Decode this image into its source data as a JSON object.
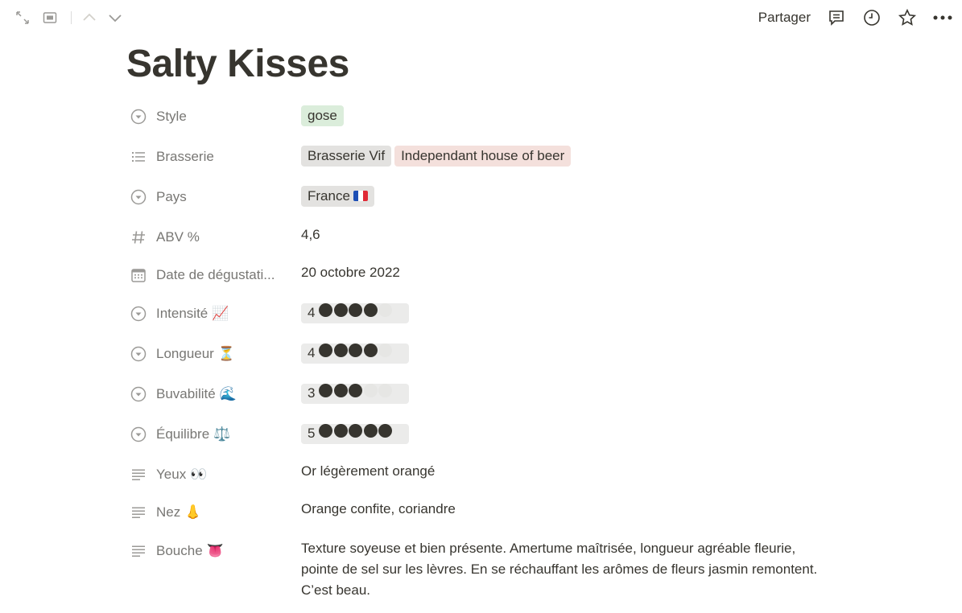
{
  "topbar": {
    "share_label": "Partager",
    "left_icons": [
      "expand-icon",
      "sidepeek-icon",
      "chevron-up-icon",
      "chevron-down-icon"
    ],
    "right_icons": [
      "comment-icon",
      "history-icon",
      "star-icon",
      "more-icon"
    ]
  },
  "page": {
    "title": "Salty Kisses"
  },
  "properties": [
    {
      "name": "Style",
      "icon": "select-icon",
      "type": "select",
      "tags": [
        {
          "label": "gose",
          "color": "#dbeddb"
        }
      ]
    },
    {
      "name": "Brasserie",
      "icon": "list-icon",
      "type": "multi-select",
      "tags": [
        {
          "label": "Brasserie Vif",
          "color": "#e3e2e0"
        },
        {
          "label": "Independant house of beer",
          "color": "#f4e0dc"
        }
      ]
    },
    {
      "name": "Pays",
      "icon": "select-icon",
      "type": "select",
      "tags": [
        {
          "label": "France",
          "color": "#e3e2e0",
          "flag": "fr-flag-icon"
        }
      ]
    },
    {
      "name": "ABV %",
      "icon": "hash-icon",
      "type": "number",
      "value": "4,6"
    },
    {
      "name": "Date de dégustati...",
      "icon": "calendar-icon",
      "type": "date",
      "value": "20 octobre 2022"
    },
    {
      "name": "Intensité",
      "emoji": "📈",
      "icon": "select-icon",
      "type": "rating",
      "value": "4",
      "score": 4,
      "max": 5
    },
    {
      "name": "Longueur",
      "emoji": "⏳",
      "icon": "select-icon",
      "type": "rating",
      "value": "4",
      "score": 4,
      "max": 5
    },
    {
      "name": "Buvabilité",
      "emoji": "🌊",
      "icon": "select-icon",
      "type": "rating",
      "value": "3",
      "score": 3,
      "max": 5
    },
    {
      "name": "Équilibre",
      "emoji": "⚖️",
      "icon": "select-icon",
      "type": "rating",
      "value": "5",
      "score": 5,
      "max": 5
    },
    {
      "name": "Yeux",
      "emoji": "👀",
      "icon": "text-icon",
      "type": "text",
      "value": "Or légèrement orangé"
    },
    {
      "name": "Nez",
      "emoji": "👃",
      "icon": "text-icon",
      "type": "text",
      "value": "Orange confite, coriandre"
    },
    {
      "name": "Bouche",
      "emoji": "👅",
      "icon": "text-icon",
      "type": "text",
      "value": "Texture soyeuse et bien présente. Amertume maîtrisée, longueur agréable fleurie, pointe de sel sur les lèvres. En se réchauffant les arômes de fleurs jasmin remontent. C’est beau."
    }
  ]
}
